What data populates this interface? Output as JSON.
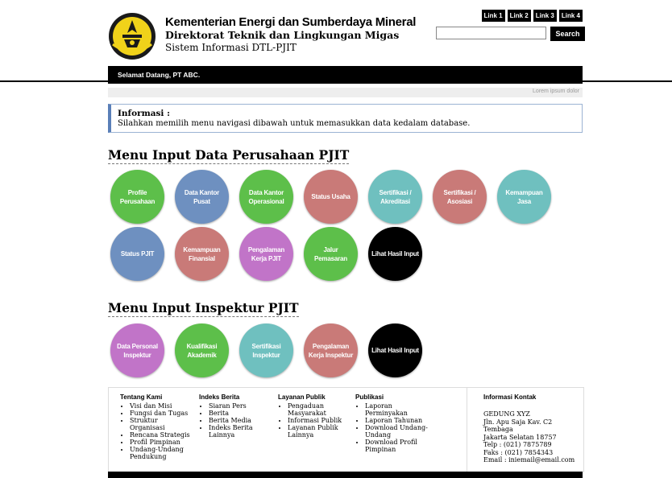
{
  "header": {
    "title": "Kementerian Energi dan Sumberdaya Mineral",
    "subtitle": "Direktorat Teknik dan Lingkungan Migas",
    "system": "Sistem Informasi DTL-PJIT"
  },
  "top_links": [
    "Link 1",
    "Link 2",
    "Link 3",
    "Link 4"
  ],
  "search": {
    "value": "",
    "button": "Search"
  },
  "navbar": {
    "welcome": "Selamat Datang, PT ABC."
  },
  "subbar": {
    "text": "Lorem ipsum dolor"
  },
  "info": {
    "title": "Informasi :",
    "text": "Silahkan memilih menu navigasi dibawah untuk memasukkan data kedalam database."
  },
  "section1": {
    "title": "Menu Input Data Perusahaan PJIT",
    "items": [
      {
        "label": "Profile Perusahaan",
        "color": "#5dbf4a"
      },
      {
        "label": "Data Kantor Pusat",
        "color": "#6e90c0"
      },
      {
        "label": "Data Kantor Operasional",
        "color": "#5dbf4a"
      },
      {
        "label": "Status Usaha",
        "color": "#c97a78"
      },
      {
        "label": "Sertifikasi / Akreditasi",
        "color": "#6fc0bf"
      },
      {
        "label": "Sertifikasi / Asosiasi",
        "color": "#c97a78"
      },
      {
        "label": "Kemampuan Jasa",
        "color": "#6fc0bf"
      },
      {
        "label": "Status PJIT",
        "color": "#6e90c0"
      },
      {
        "label": "Kemampuan Finansial",
        "color": "#c97a78"
      },
      {
        "label": "Pengalaman Kerja PJIT",
        "color": "#c174c8"
      },
      {
        "label": "Jalur Pemasaran",
        "color": "#5dbf4a"
      },
      {
        "label": "Lihat Hasil Input",
        "color": "#000000"
      }
    ]
  },
  "section2": {
    "title": "Menu Input Inspektur PJIT",
    "items": [
      {
        "label": "Data Personal Inspektur",
        "color": "#c174c8"
      },
      {
        "label": "Kualifikasi Akademik",
        "color": "#5dbf4a"
      },
      {
        "label": "Sertifikasi Inspektur",
        "color": "#6fc0bf"
      },
      {
        "label": "Pengalaman Kerja Inspektur",
        "color": "#c97a78"
      },
      {
        "label": "Lihat Hasil Input",
        "color": "#000000"
      }
    ]
  },
  "footer": {
    "col1": {
      "title": "Tentang Kami",
      "items": [
        "Visi dan Misi",
        "Fungsi dan Tugas",
        "Struktur Organisasi",
        "Rencana Strategis",
        "Profil Pimpinan",
        "Undang-Undang Pendukung"
      ]
    },
    "col2": {
      "title": "Indeks Berita",
      "items": [
        "Siaran Pers",
        "Berita",
        "Berita Media",
        "Indeks Berita Lainnya"
      ]
    },
    "col3": {
      "title": "Layanan Publik",
      "items": [
        "Pengaduan Masyarakat",
        "Informasi Publik",
        "Layanan Publik Lainnya"
      ]
    },
    "col4": {
      "title": "Publikasi",
      "items": [
        "Laporan Perminyakan",
        "Laporan Tahunan",
        "Download Undang-Undang",
        "Download Profil Pimpinan"
      ]
    },
    "contact": {
      "title": "Informasi Kontak",
      "lines": [
        "GEDUNG XYZ",
        "Jln. Apu Saja Kav. C2 Tembaga",
        "Jakarta Selatan 18757",
        "Telp : (021) 7875789",
        "Faks : (021) 7854343",
        "Email : iniemail@email.com"
      ]
    }
  }
}
